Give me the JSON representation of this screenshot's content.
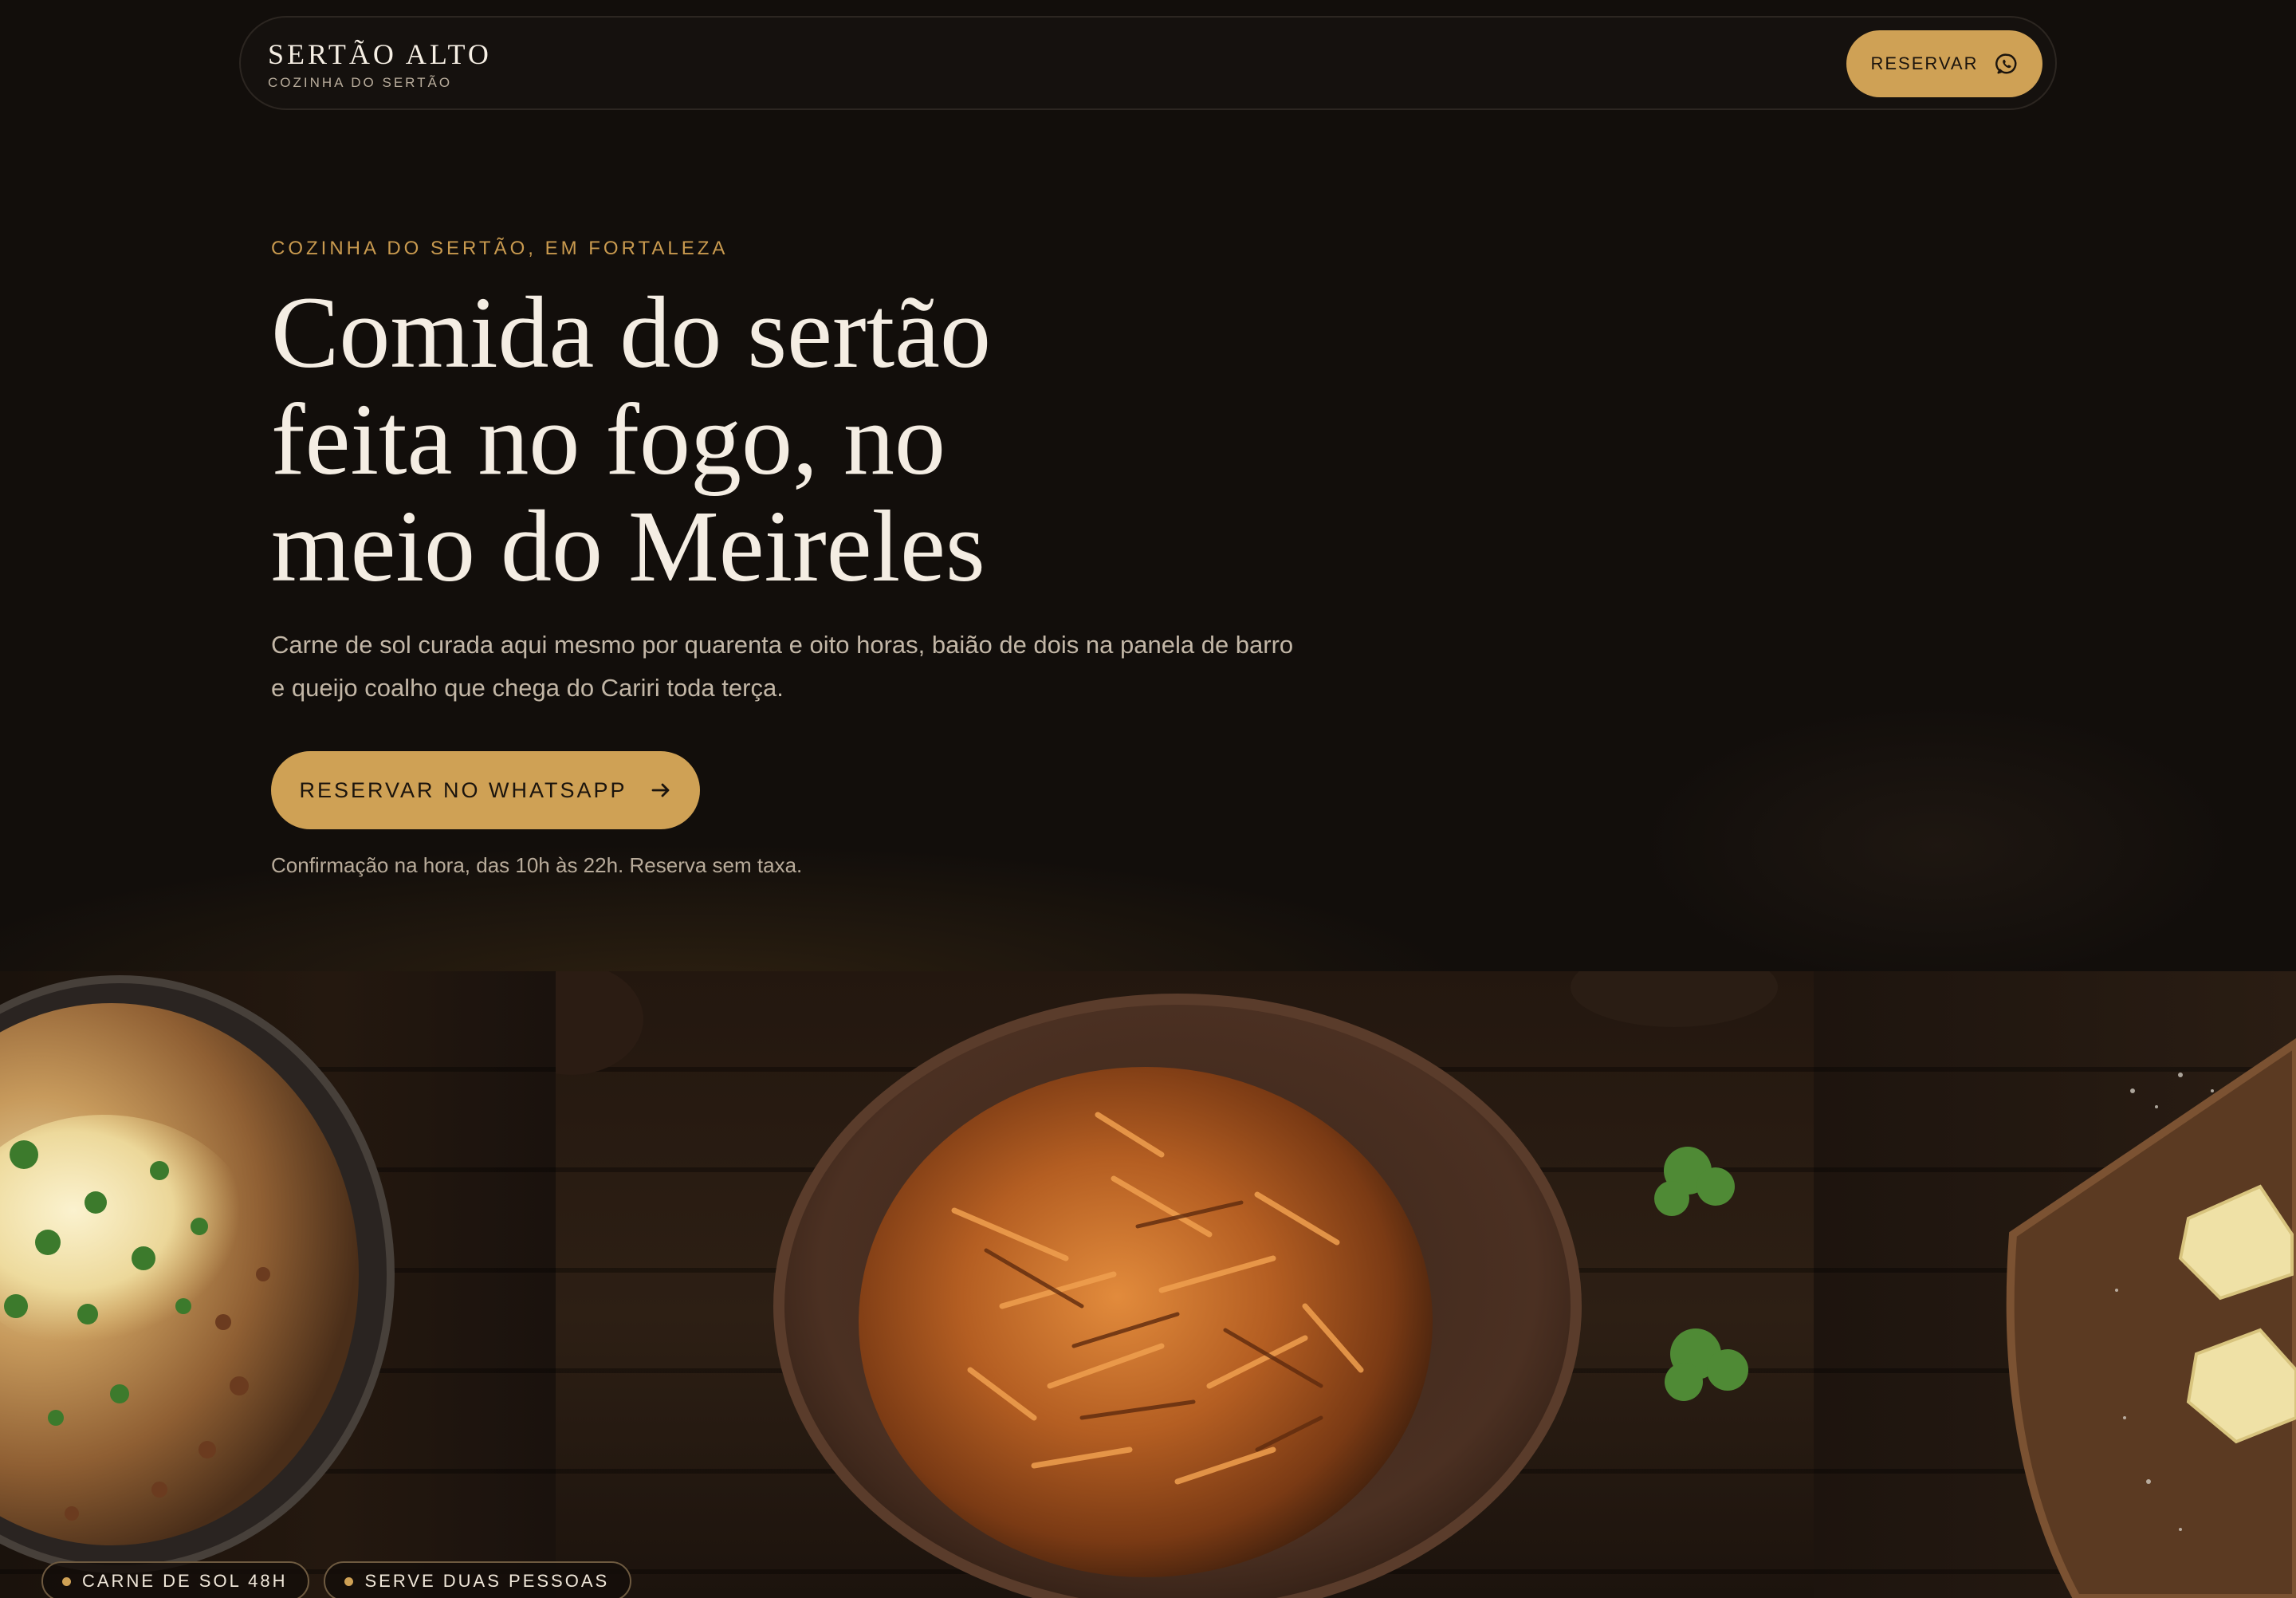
{
  "nav": {
    "brand_name": "SERTÃO ALTO",
    "brand_sub": "COZINHA DO SERTÃO",
    "reserve_label": "RESERVAR",
    "reserve_icon": "whatsapp-icon"
  },
  "hero": {
    "eyebrow": "COZINHA DO SERTÃO, EM FORTALEZA",
    "headline": "Comida do sertão feita no fogo, no meio do Meireles",
    "subtitle": "Carne de sol curada aqui mesmo por quarenta e oito horas, baião de dois na panela de barro e queijo coalho que chega do Cariri toda terça.",
    "cta_label": "RESERVAR NO WHATSAPP",
    "cta_icon": "arrow-right-icon",
    "note": "Confirmação na hora, das 10h às 22h. Reserva sem taxa."
  },
  "tags": [
    {
      "label": "CARNE DE SOL 48H"
    },
    {
      "label": "SERVE DUAS PESSOAS"
    }
  ],
  "colors": {
    "background": "#120e0b",
    "accent": "#cfa155",
    "headline": "#f4ede3",
    "muted": "#c2b6a6"
  }
}
